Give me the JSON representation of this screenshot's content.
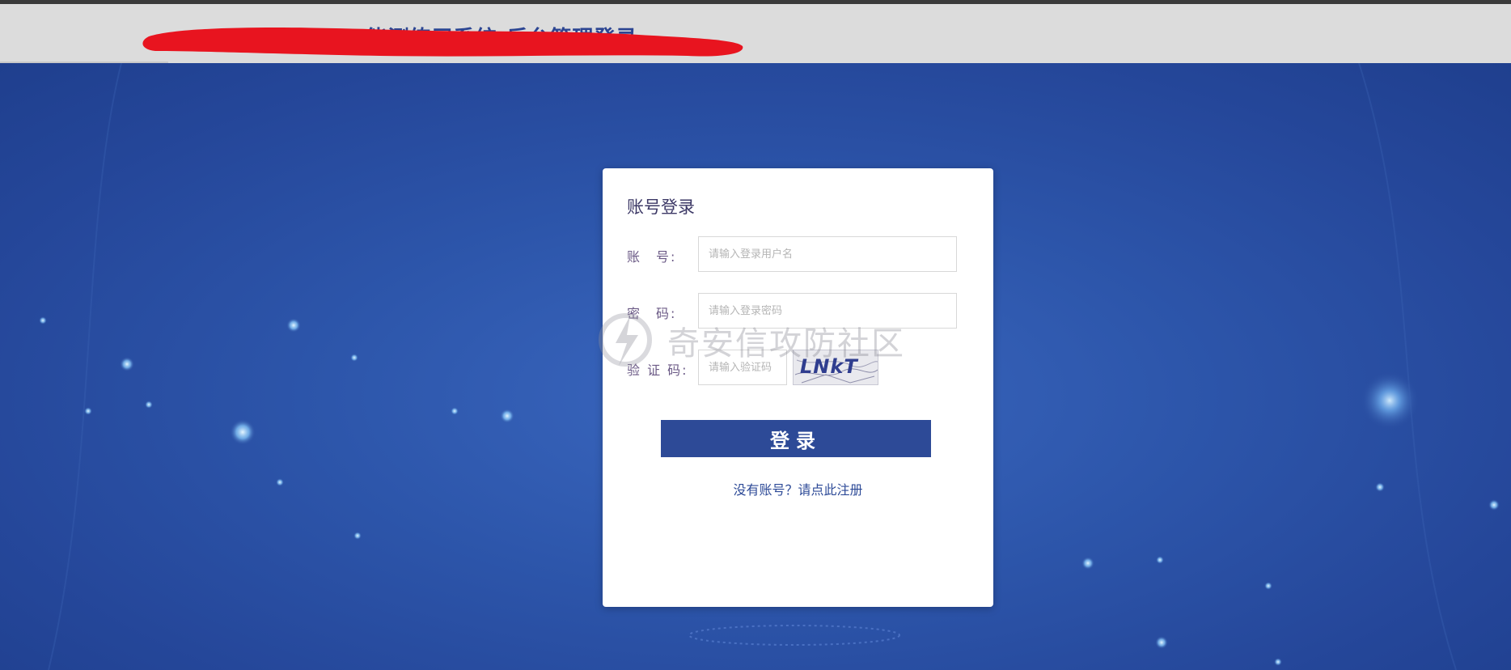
{
  "header": {
    "title": "...能测练习系统-后台管理登录"
  },
  "login": {
    "title": "账号登录",
    "account_label": "账　号:",
    "account_placeholder": "请输入登录用户名",
    "password_label": "密　码:",
    "password_placeholder": "请输入登录密码",
    "captcha_label": "验 证 码:",
    "captcha_placeholder": "请输入验证码",
    "captcha_text": "LNkT",
    "submit_label": "登录",
    "register_link": "没有账号？请点此注册"
  },
  "watermark": {
    "text": "奇安信攻防社区"
  },
  "colors": {
    "accent": "#2d4a97",
    "background": "#2c4ea0",
    "redaction": "#e8141f"
  }
}
